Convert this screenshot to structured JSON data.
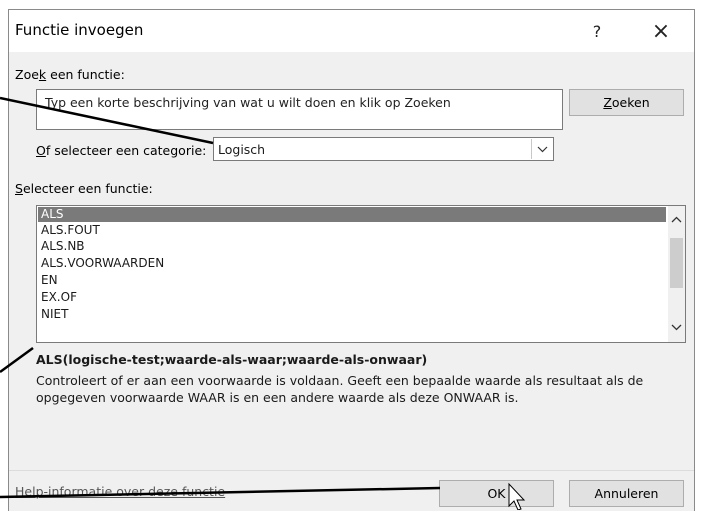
{
  "dialog": {
    "title": "Functie invoegen",
    "help_glyph": "?",
    "close_glyph": "×"
  },
  "search": {
    "label_pre": "Zoe",
    "label_key": "k",
    "label_post": " een functie:",
    "input_text": "Typ een korte beschrijving van wat u wilt doen en klik op Zoeken",
    "button_key": "Z",
    "button_rest": "oeken"
  },
  "category": {
    "label_key": "O",
    "label_rest": "f selecteer een categorie:",
    "selected": "Logisch"
  },
  "function_list": {
    "label_key": "S",
    "label_rest": "electeer een functie:",
    "items": [
      "ALS",
      "ALS.FOUT",
      "ALS.NB",
      "ALS.VOORWAARDEN",
      "EN",
      "EX.OF",
      "NIET"
    ],
    "selected_index": 0
  },
  "details": {
    "signature": "ALS(logische-test;waarde-als-waar;waarde-als-onwaar)",
    "description": "Controleert of er aan een voorwaarde is voldaan. Geeft een bepaalde waarde als resultaat als de opgegeven voorwaarde WAAR is en een andere waarde als deze ONWAAR is."
  },
  "footer": {
    "help_link": "Help-informatie over deze functie",
    "ok_label": "OK",
    "cancel_label": "Annuleren"
  },
  "icons": [
    "help-icon",
    "close-icon",
    "chevron-down-icon",
    "scroll-up-icon",
    "scroll-down-icon",
    "mouse-pointer-icon"
  ]
}
